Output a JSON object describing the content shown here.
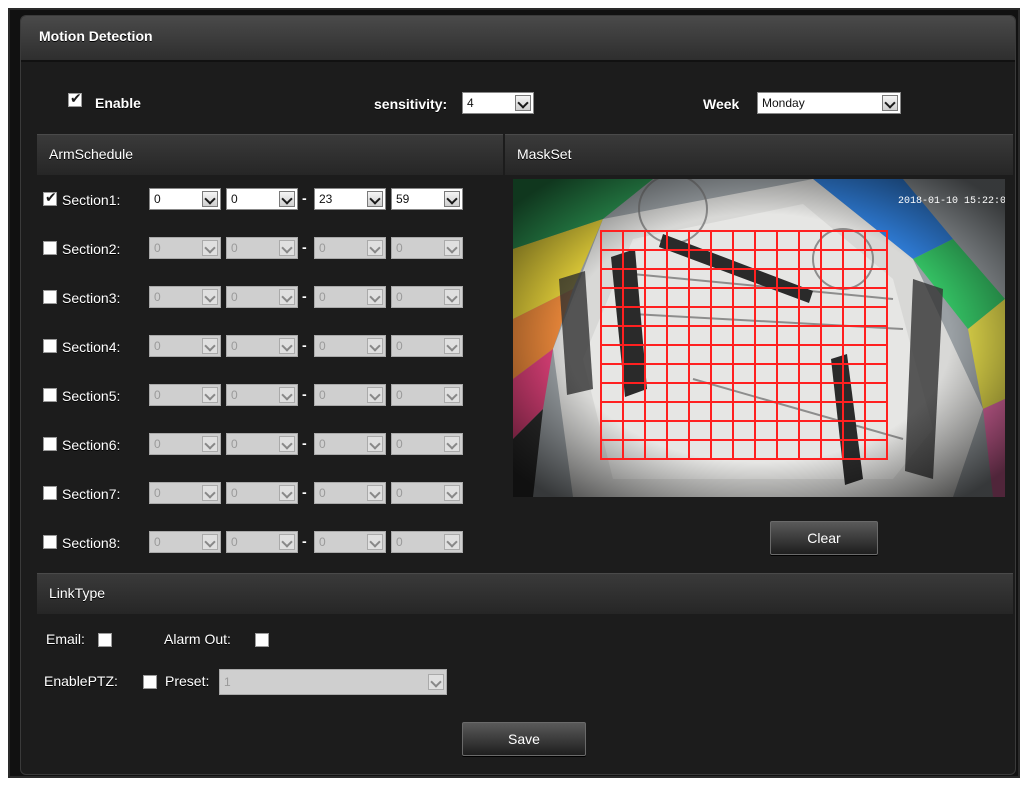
{
  "title": "Motion Detection",
  "enable": {
    "label": "Enable",
    "checked": true
  },
  "sensitivity": {
    "label": "sensitivity:",
    "value": "4"
  },
  "week": {
    "label": "Week",
    "value": "Monday"
  },
  "arm_schedule": {
    "header": "ArmSchedule",
    "sections": [
      {
        "label": "Section1:",
        "checked": true,
        "start_h": "0",
        "start_m": "0",
        "end_h": "23",
        "end_m": "59"
      },
      {
        "label": "Section2:",
        "checked": false,
        "start_h": "0",
        "start_m": "0",
        "end_h": "0",
        "end_m": "0"
      },
      {
        "label": "Section3:",
        "checked": false,
        "start_h": "0",
        "start_m": "0",
        "end_h": "0",
        "end_m": "0"
      },
      {
        "label": "Section4:",
        "checked": false,
        "start_h": "0",
        "start_m": "0",
        "end_h": "0",
        "end_m": "0"
      },
      {
        "label": "Section5:",
        "checked": false,
        "start_h": "0",
        "start_m": "0",
        "end_h": "0",
        "end_m": "0"
      },
      {
        "label": "Section6:",
        "checked": false,
        "start_h": "0",
        "start_m": "0",
        "end_h": "0",
        "end_m": "0"
      },
      {
        "label": "Section7:",
        "checked": false,
        "start_h": "0",
        "start_m": "0",
        "end_h": "0",
        "end_m": "0"
      },
      {
        "label": "Section8:",
        "checked": false,
        "start_h": "0",
        "start_m": "0",
        "end_h": "0",
        "end_m": "0"
      }
    ],
    "separator": "-"
  },
  "mask_set": {
    "header": "MaskSet",
    "timestamp": "2018-01-10 15:22:0",
    "mask_color": "#ff2020",
    "clear_label": "Clear"
  },
  "link_type": {
    "header": "LinkType",
    "email_label": "Email:",
    "email_checked": false,
    "alarm_out_label": "Alarm Out:",
    "alarm_out_checked": false,
    "enable_ptz_label": "EnablePTZ:",
    "enable_ptz_checked": false,
    "preset_label": "Preset:",
    "preset_value": "1"
  },
  "save_label": "Save"
}
